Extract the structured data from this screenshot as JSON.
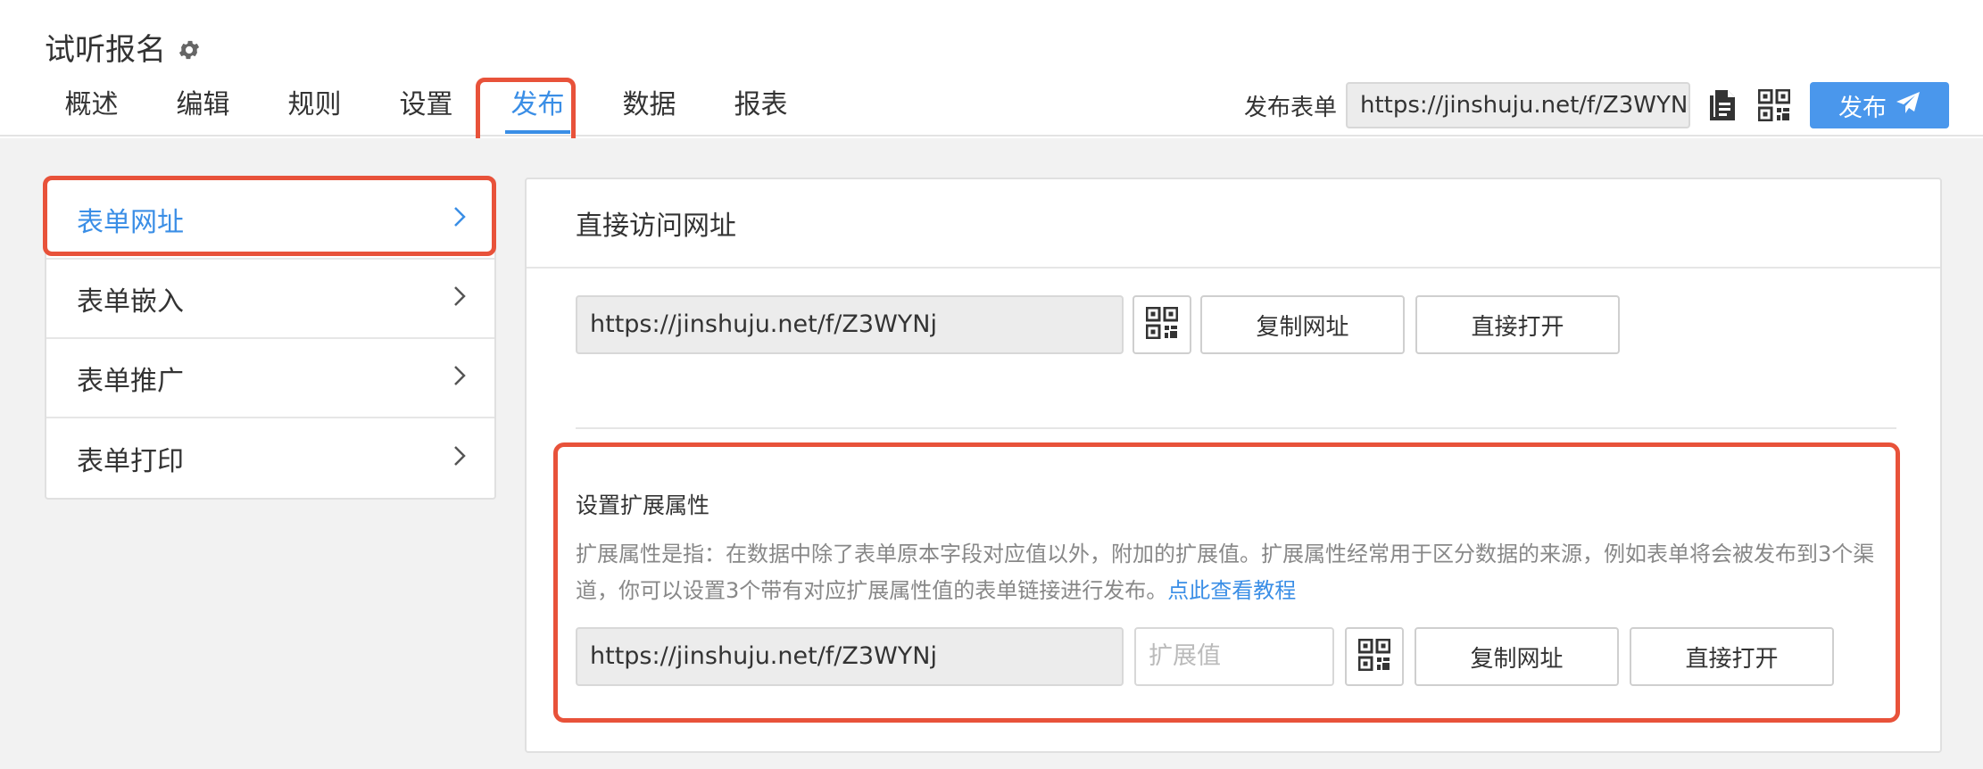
{
  "header": {
    "title": "试听报名",
    "tabs": [
      "概述",
      "编辑",
      "规则",
      "设置",
      "发布",
      "数据",
      "报表"
    ],
    "active_tab": "发布",
    "publish_label": "发布表单",
    "publish_url": "https://jinshuju.net/f/Z3WYN",
    "publish_button": "发布"
  },
  "sidebar": {
    "items": [
      {
        "label": "表单网址"
      },
      {
        "label": "表单嵌入"
      },
      {
        "label": "表单推广"
      },
      {
        "label": "表单打印"
      }
    ],
    "active": "表单网址"
  },
  "panel": {
    "title": "直接访问网址",
    "direct": {
      "url": "https://jinshuju.net/f/Z3WYNj",
      "copy_label": "复制网址",
      "open_label": "直接打开"
    },
    "extension": {
      "title": "设置扩展属性",
      "description": "扩展属性是指：在数据中除了表单原本字段对应值以外，附加的扩展值。扩展属性经常用于区分数据的来源，例如表单将会被发布到3个渠道，你可以设置3个带有对应扩展属性值的表单链接进行发布。",
      "link_text": "点此查看教程",
      "url": "https://jinshuju.net/f/Z3WYNj",
      "input_placeholder": "扩展值",
      "copy_label": "复制网址",
      "open_label": "直接打开"
    }
  },
  "colors": {
    "accent": "#3a8ee6",
    "primary_button": "#4a97ec",
    "highlight": "#e8523a"
  }
}
